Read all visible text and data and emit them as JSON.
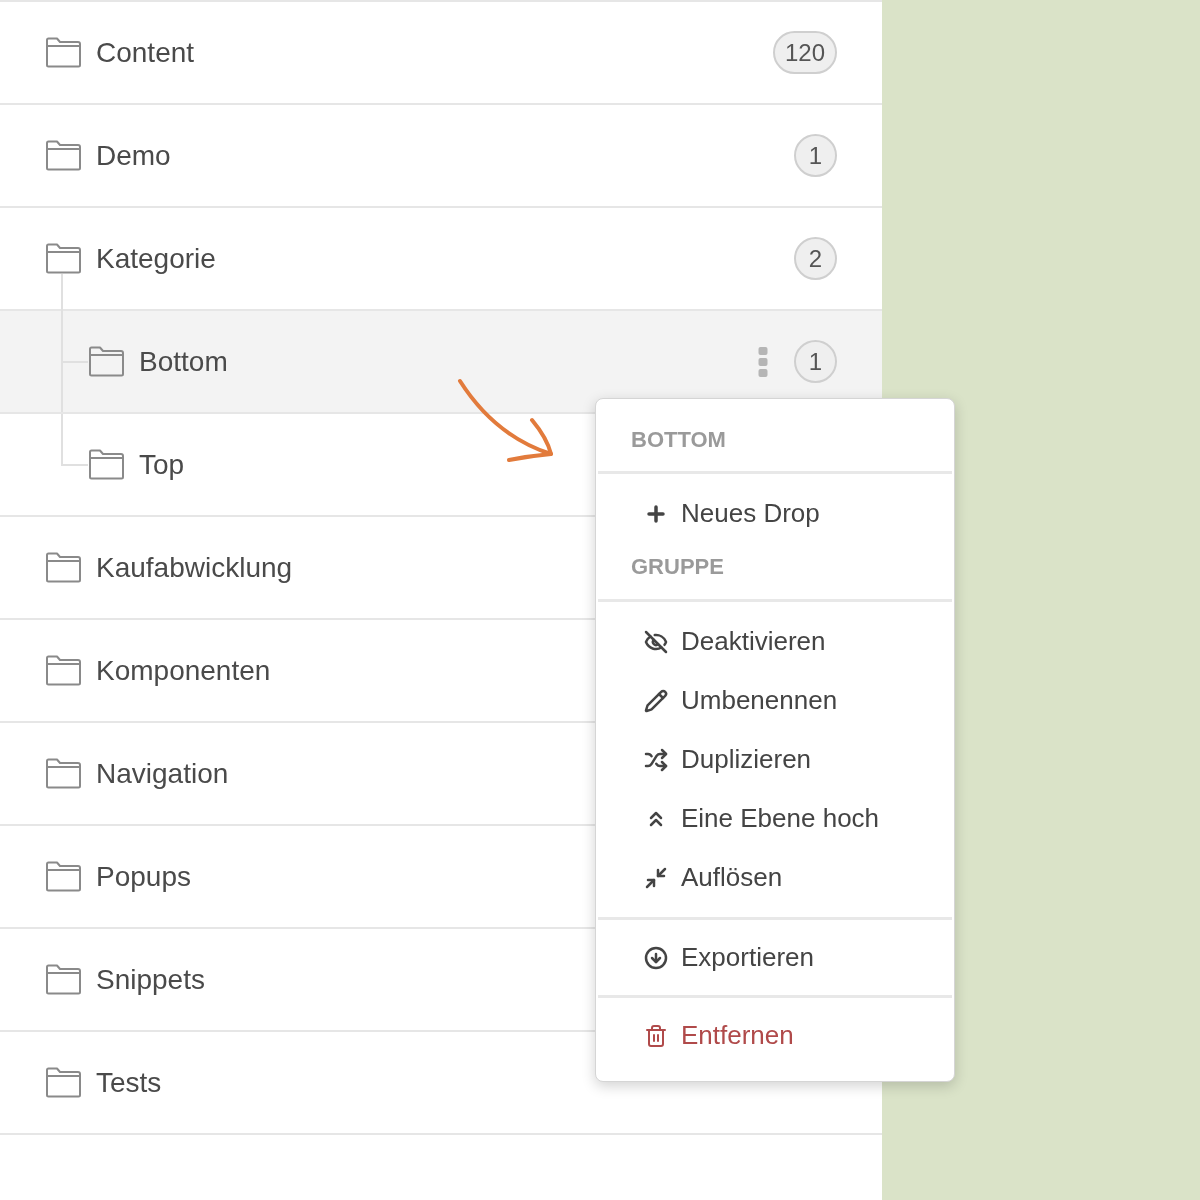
{
  "folders": [
    {
      "name": "Content",
      "count": "120",
      "selected": false
    },
    {
      "name": "Demo",
      "count": "1",
      "selected": false
    },
    {
      "name": "Kategorie",
      "count": "2",
      "selected": false,
      "children": [
        {
          "name": "Bottom",
          "count": "1",
          "selected": true
        },
        {
          "name": "Top",
          "selected": false
        }
      ]
    },
    {
      "name": "Kaufabwicklung",
      "selected": false
    },
    {
      "name": "Komponenten",
      "selected": false
    },
    {
      "name": "Navigation",
      "selected": false
    },
    {
      "name": "Popups",
      "selected": false
    },
    {
      "name": "Snippets",
      "selected": false
    },
    {
      "name": "Tests",
      "selected": false
    }
  ],
  "context_menu": {
    "sections": [
      {
        "heading": "BOTTOM",
        "items": [
          {
            "label": "Neues Drop",
            "kind": "add",
            "danger": false
          }
        ]
      },
      {
        "heading": "GRUPPE",
        "items": [
          {
            "label": "Deaktivieren",
            "kind": "hide",
            "danger": false
          },
          {
            "label": "Umbenennen",
            "kind": "rename",
            "danger": false
          },
          {
            "label": "Duplizieren",
            "kind": "duplicate",
            "danger": false
          },
          {
            "label": "Eine Ebene hoch",
            "kind": "levelup",
            "danger": false
          },
          {
            "label": "Auflösen",
            "kind": "dissolve",
            "danger": false
          }
        ]
      },
      {
        "items": [
          {
            "label": "Exportieren",
            "kind": "export",
            "danger": false
          }
        ]
      },
      {
        "items": [
          {
            "label": "Entfernen",
            "kind": "remove",
            "danger": true
          }
        ]
      }
    ]
  }
}
